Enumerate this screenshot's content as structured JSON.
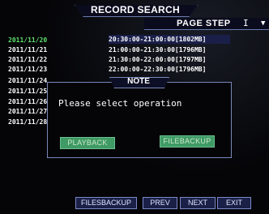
{
  "window": {
    "title": "RECORD SEARCH",
    "page_step_label": "PAGE STEP",
    "page_step_value": "I",
    "page_step_arrow": "▼"
  },
  "dates": [
    {
      "label": "2011/11/20",
      "selected": true
    },
    {
      "label": "2011/11/21",
      "selected": false
    },
    {
      "label": "2011/11/22",
      "selected": false
    },
    {
      "label": "2011/11/23",
      "selected": false
    },
    {
      "label": "2011/11/24",
      "selected": false
    },
    {
      "label": "2011/11/25",
      "selected": false
    },
    {
      "label": "2011/11/26",
      "selected": false
    },
    {
      "label": "2011/11/27",
      "selected": false
    },
    {
      "label": "2011/11/28",
      "selected": false
    }
  ],
  "records": [
    {
      "label": "20:30:00-21:00:00[1802MB]",
      "selected": true
    },
    {
      "label": "21:00:00-21:30:00[1796MB]",
      "selected": false
    },
    {
      "label": "21:30:00-22:00:00[1797MB]",
      "selected": false
    },
    {
      "label": "22:00:00-22:30:00[1796MB]",
      "selected": false
    }
  ],
  "dialog": {
    "title": "NOTE",
    "message": "Please select operation",
    "playback_label": "PLAYBACK",
    "filebackup_label": "FILEBACKUP"
  },
  "bottom_bar": {
    "filebackup_label": "FILESBACKUP",
    "prev_label": "PREV",
    "next_label": "NEXT",
    "exit_label": "EXIT"
  },
  "colors": {
    "selected_date": "#5fe06a",
    "button_green": "#3f9a66",
    "border": "#7b88b8",
    "background": "#050508"
  }
}
